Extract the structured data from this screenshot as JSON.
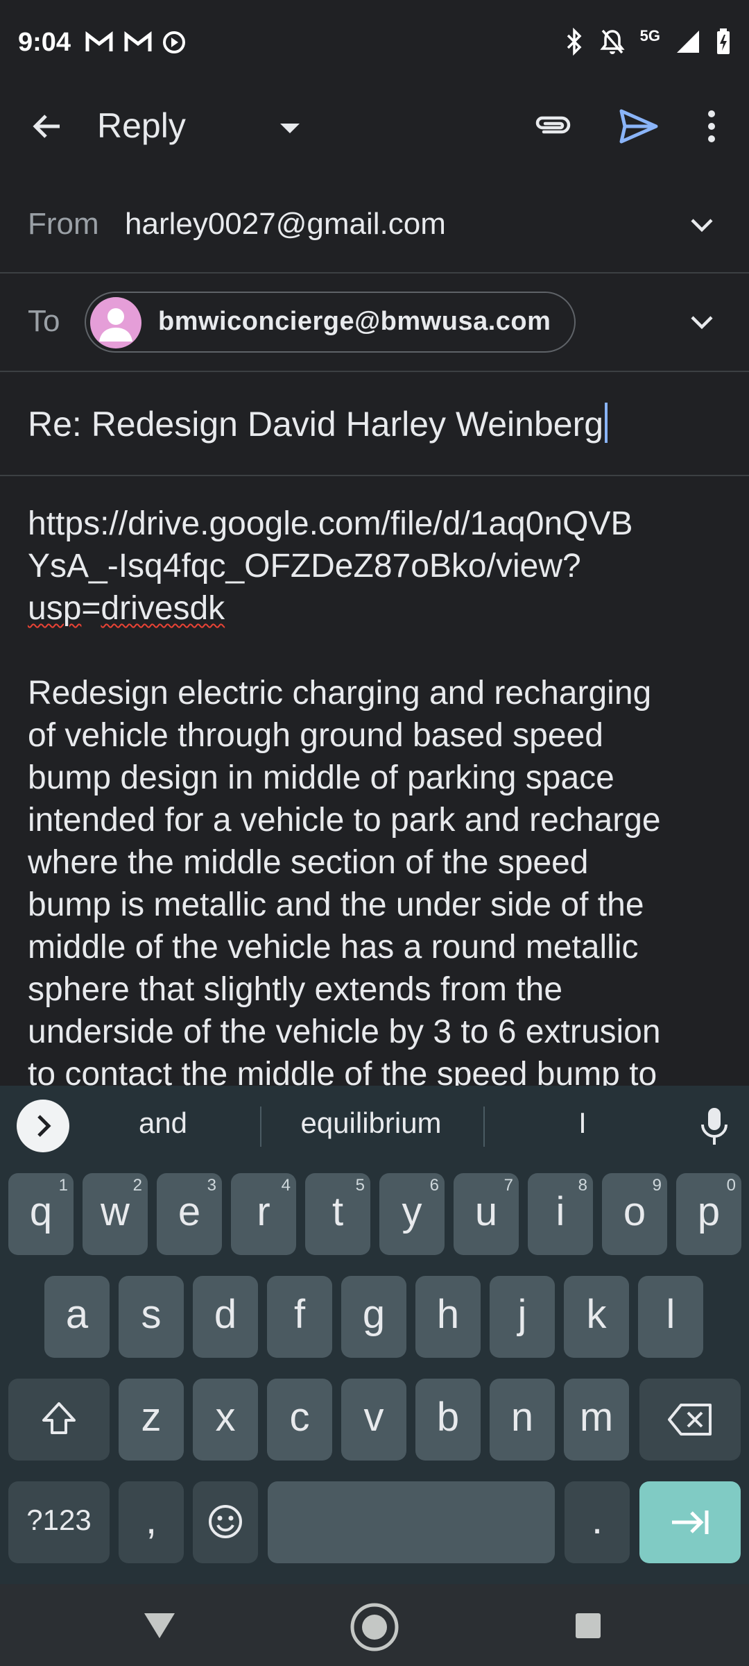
{
  "status_bar": {
    "time": "9:04",
    "network": "5G",
    "left_icons": [
      "gmail-icon",
      "gmail-icon",
      "media-play-icon"
    ],
    "right_icons": [
      "bluetooth-icon",
      "notifications-off-icon",
      "signal-icon",
      "battery-icon"
    ]
  },
  "app_bar": {
    "title": "Reply",
    "icons": [
      "back-arrow-icon",
      "dropdown-caret-icon",
      "attach-icon",
      "send-icon",
      "more-vert-icon"
    ],
    "send_color": "#8ab4f8"
  },
  "compose": {
    "from_label": "From",
    "from_value": "harley0027@gmail.com",
    "to_label": "To",
    "to_recipient": "bmwiconcierge@bmwusa.com",
    "subject": "Re: Redesign David Harley Weinberg",
    "body": {
      "link_line1": "https://drive.google.com/file/d/1aq0nQVB",
      "link_line2": "YsA_-Isq4fqc_OFZDeZ87oBko/view?",
      "link_line3_a": "usp",
      "link_line3_b": "=",
      "link_line3_c": "drivesdk",
      "paragraph": [
        "Redesign electric charging and recharging",
        "of vehicle through ground based speed",
        "bump design in middle of parking space",
        "intended for a vehicle to park and recharge",
        "where the middle section of the speed",
        "bump is metallic and the under side of the",
        "middle of the vehicle has a round metallic",
        "sphere that slightly extends from the",
        "underside of the vehicle by 3 to 6 extrusion",
        "to contact the middle of the speed bump to"
      ]
    }
  },
  "keyboard": {
    "suggestions": [
      "and",
      "equilibrium",
      "I"
    ],
    "row1": [
      "q",
      "w",
      "e",
      "r",
      "t",
      "y",
      "u",
      "i",
      "o",
      "p"
    ],
    "row1_hints": [
      "1",
      "2",
      "3",
      "4",
      "5",
      "6",
      "7",
      "8",
      "9",
      "0"
    ],
    "row2": [
      "a",
      "s",
      "d",
      "f",
      "g",
      "h",
      "j",
      "k",
      "l"
    ],
    "row3": [
      "z",
      "x",
      "c",
      "v",
      "b",
      "n",
      "m"
    ],
    "symbols_key": "?123",
    "comma_key": ",",
    "period_key": ".",
    "enter_color": "#80cbc4"
  },
  "nav_bar": {
    "icons": [
      "nav-back-icon",
      "nav-home-icon",
      "nav-recents-icon"
    ]
  }
}
